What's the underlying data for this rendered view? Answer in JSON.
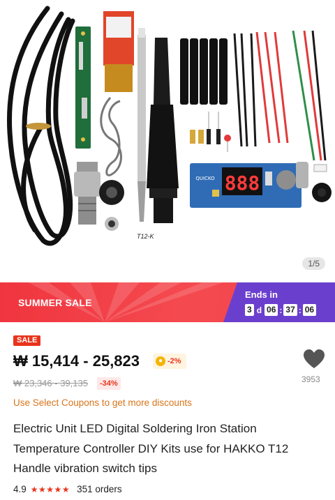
{
  "gallery": {
    "tip_label": "T12-K",
    "display_digits": "888",
    "board_brand": "QUICKO",
    "page_counter": "1/5"
  },
  "banner": {
    "sale_name": "SUMMER SALE",
    "ends_label": "Ends in",
    "days": "3",
    "days_unit": "d",
    "hours": "06",
    "minutes": "37",
    "seconds": "06"
  },
  "product": {
    "sale_tag": "SALE",
    "price": "₩ 15,414 - 25,823",
    "coin_discount": "-2%",
    "original_price": "₩ 23,346 - 39,135",
    "discount": "-34%",
    "coupon_text": "Use Select Coupons to get more discounts",
    "title": "Electric Unit LED Digital Soldering Iron Station Temperature Controller DIY Kits use for HAKKO T12 Handle vibration switch tips",
    "rating": "4.9",
    "stars": "★★★★★",
    "orders": "351 orders",
    "wishlist_count": "3953"
  },
  "colors": {
    "banner_red": "#f0353f",
    "banner_purple": "#6b3fce",
    "accent_red": "#e8341c",
    "coupon_orange": "#d8741a"
  },
  "icons": [
    "heart-icon",
    "coin-icon",
    "star-icon"
  ]
}
